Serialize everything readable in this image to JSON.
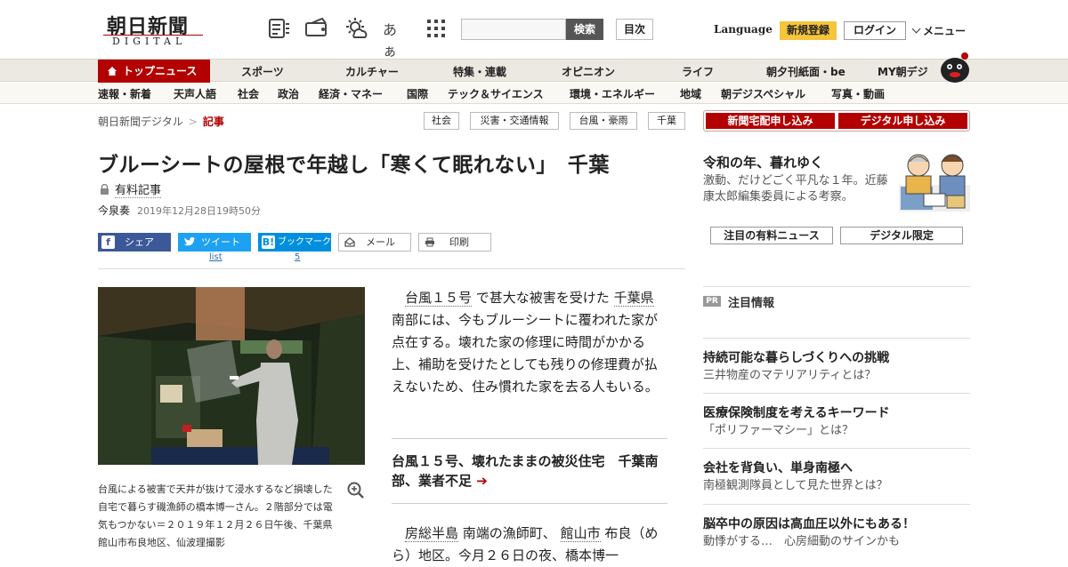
{
  "header": {
    "logo_jp": "朝日新聞",
    "logo_en": "DIGITAL",
    "search_button": "検索",
    "mokuji": "目次",
    "language": "Language",
    "signup": "新規登録",
    "login": "ログイン",
    "menu": "メニュー",
    "font_icon_text": "あぁ"
  },
  "nav_primary": {
    "top_news": "トップニュース",
    "items": [
      "スポーツ",
      "カルチャー",
      "特集・連載",
      "オピニオン",
      "ライフ",
      "朝夕刊紙面・be",
      "MY朝デジ"
    ]
  },
  "nav_secondary": {
    "items": [
      "速報・新着",
      "天声人語",
      "社会",
      "政治",
      "経済・マネー",
      "国際",
      "テック＆サイエンス",
      "環境・エネルギー",
      "地域",
      "朝デジスペシャル",
      "写真・動画"
    ]
  },
  "breadcrumb": {
    "home": "朝日新聞デジタル",
    "separator": ">",
    "current": "記事"
  },
  "tags": [
    "社会",
    "災害・交通情報",
    "台風・豪雨",
    "千葉"
  ],
  "article": {
    "title": "ブルーシートの屋根で年越し「寒くて眠れない」　千葉",
    "paid_label": "有料記事",
    "author": "今泉奏",
    "datetime": "2019年12月28日19時50分",
    "share": {
      "facebook": "シェア",
      "twitter": "ツイート",
      "twitter_count": "list",
      "hatena": "ブックマーク",
      "hatena_count": "5",
      "mail": "メール",
      "print": "印刷"
    },
    "caption": "台風による被害で天井が抜けて浸水するなど損壊した自宅で暮らす磯漁師の橋本博一さん。２階部分では電気もつかない＝２０１９年１２月２６日午後、千葉県館山市布良地区、仙波理撮影",
    "p1": {
      "kw1": "台風１５号",
      "t1": " で甚大な被害を受けた ",
      "kw2": "千葉県",
      "t2": " 南部には、今もブルーシートに覆われた家が点在する。壊れた家の修理に時間がかかる上、補助を受けたとしても残りの修理費が払えないため、住み慣れた家を去る人もいる。"
    },
    "related": "台風１５号、壊れたままの被災住宅　千葉南部、業者不足",
    "related_arrow": "➔",
    "p2": {
      "kw1": "房総半島",
      "t1": " 南端の漁師町、 ",
      "kw2": "館山市",
      "t2": " 布良（めら）地区。今月２６日の夜、橋本博一"
    }
  },
  "sidebar": {
    "subscribe_paper": "新聞宅配申し込み",
    "subscribe_digital": "デジタル申し込み",
    "promo_title": "令和の年、暮れゆく",
    "promo_text": "激動、だけどごく平凡な１年。近藤康太郎編集委員による考察。",
    "link_paid_news": "注目の有料ニュース",
    "link_digital_only": "デジタル限定",
    "pr_badge": "PR",
    "pr_title": "注目情報",
    "pr_items": [
      {
        "headline": "持続可能な暮らしづくりへの挑戦",
        "sub": "三井物産のマテリアリティとは？"
      },
      {
        "headline": "医療保険制度を考えるキーワード",
        "sub": "「ポリファーマシー」とは？"
      },
      {
        "headline": "会社を背負い、単身南極へ",
        "sub": "南極観測隊員として見た世界とは？"
      },
      {
        "headline": "脳卒中の原因は高血圧以外にもある！",
        "sub": "動悸がする…　心房細動のサインかも"
      }
    ]
  },
  "colors": {
    "brand_red": "#b30000",
    "facebook": "#3b5998",
    "twitter": "#1da1f2",
    "hatena": "#008fde",
    "signup_yellow": "#f5c53a"
  }
}
